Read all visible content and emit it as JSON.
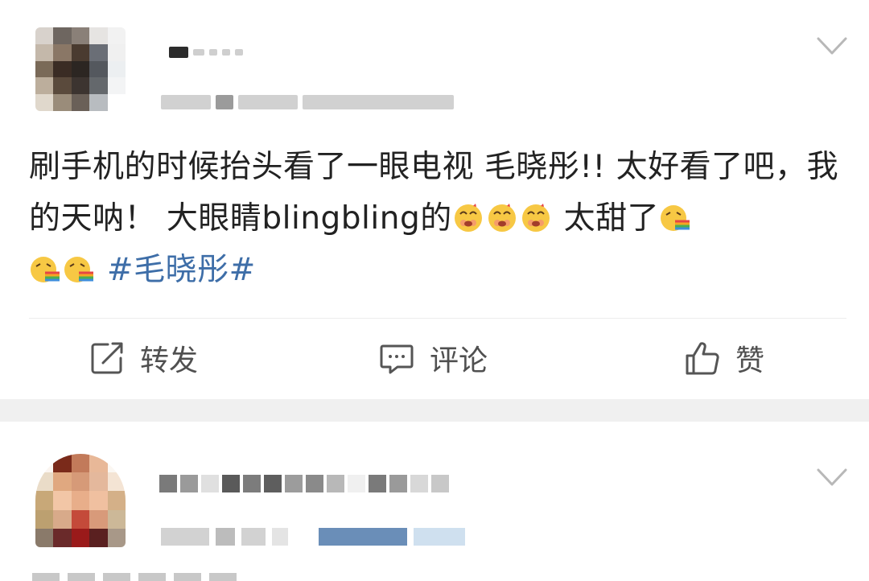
{
  "post": {
    "text_parts": {
      "line_a": "刷手机的时候抬头看了一眼电视  毛晓彤!!  太好看了吧，我的天呐！ 大眼睛blingbling的",
      "line_b": " 太甜了",
      "hashtag": "#毛晓彤#"
    },
    "emojis": {
      "first_group": [
        "heart-eyes-emoji",
        "heart-eyes-emoji",
        "heart-eyes-emoji"
      ],
      "after_sweet": [
        "rainbow-vomit-emoji"
      ],
      "before_hashtag": [
        "rainbow-vomit-emoji",
        "rainbow-vomit-emoji"
      ]
    },
    "actions": {
      "repost_label": "转发",
      "comment_label": "评论",
      "like_label": "赞"
    },
    "author_blurred": true
  },
  "colors": {
    "hashtag": "#3e6ea8",
    "action_text": "#505050",
    "separator_band": "#f0f0f0"
  },
  "icons": {
    "repost": "share-edit-icon",
    "comment": "comment-bubble-icon",
    "like": "thumbs-up-icon",
    "more": "chevron-down-icon"
  }
}
